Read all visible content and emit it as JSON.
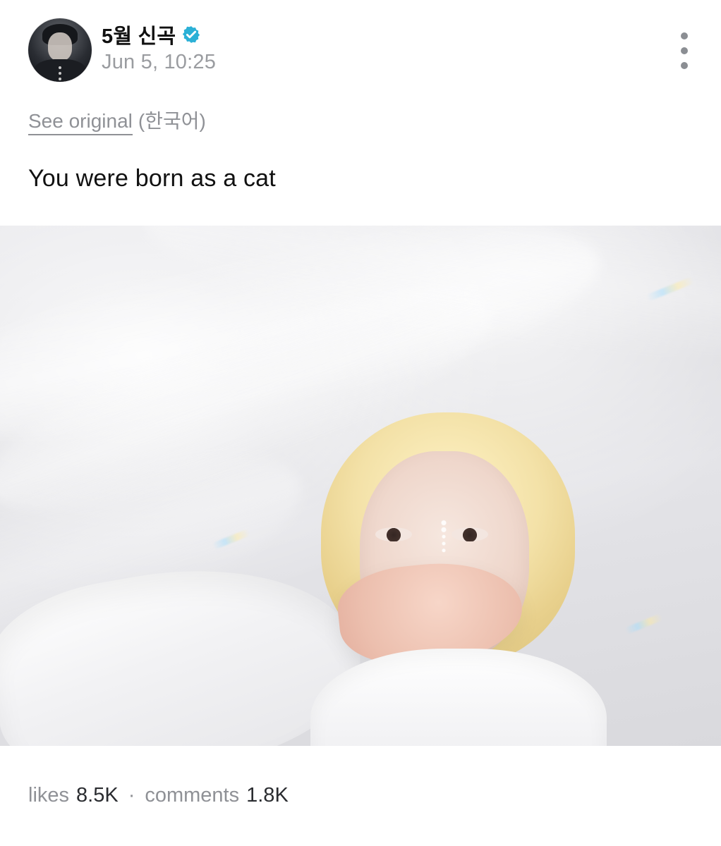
{
  "post": {
    "author": {
      "display_name": "5월 신곡",
      "verified": true,
      "verified_color": "#2bb0d6"
    },
    "timestamp": "Jun 5, 10:25",
    "translation": {
      "see_original_label": "See original",
      "language_note": "(한국어)"
    },
    "text": "You were born as a cat",
    "media": {
      "type": "photo",
      "background_color": "#e2e2e6"
    },
    "stats": {
      "likes_label": "likes",
      "likes_value": "8.5K",
      "separator": "·",
      "comments_label": "comments",
      "comments_value": "1.8K"
    }
  },
  "icons": {
    "more": "more-vertical-icon",
    "verified": "verified-badge-icon"
  }
}
